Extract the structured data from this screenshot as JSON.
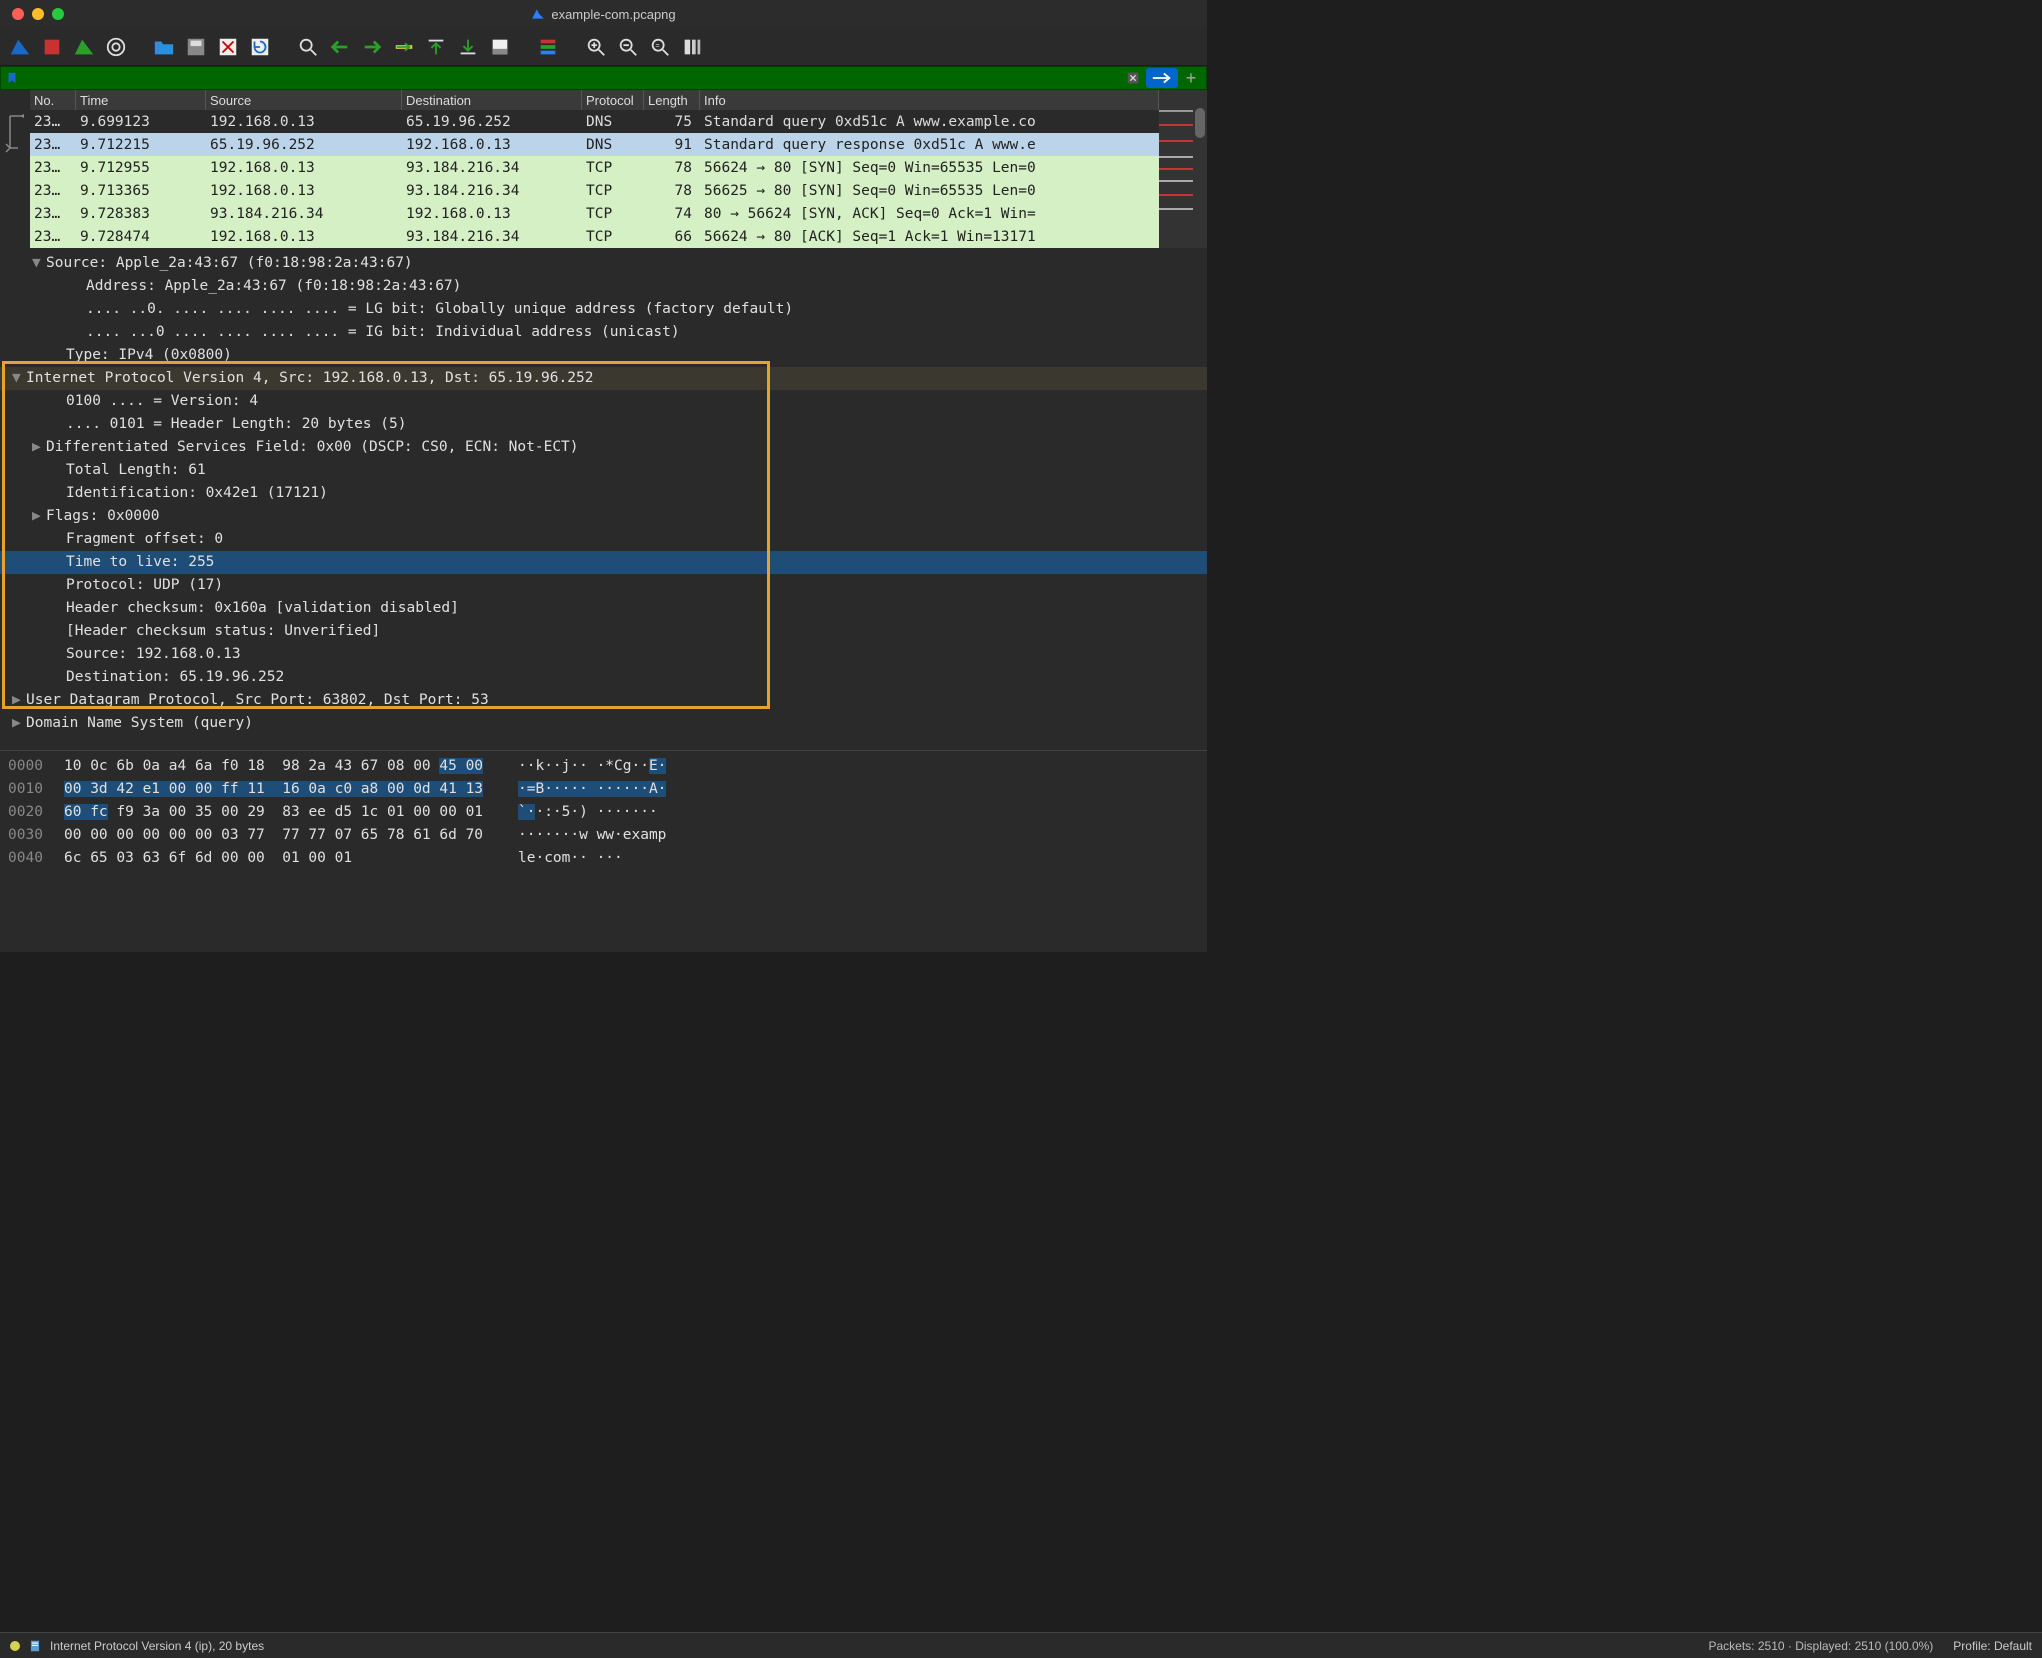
{
  "title": "example-com.pcapng",
  "filter_value": "",
  "columns": {
    "no": "No.",
    "time": "Time",
    "src": "Source",
    "dst": "Destination",
    "proto": "Protocol",
    "len": "Length",
    "info": "Info"
  },
  "packets": [
    {
      "no": "23…",
      "time": "9.699123",
      "src": "192.168.0.13",
      "dst": "65.19.96.252",
      "proto": "DNS",
      "len": "75",
      "info": "Standard query 0xd51c A www.example.co",
      "cls": "row-dns row-dark",
      "selected": false
    },
    {
      "no": "23…",
      "time": "9.712215",
      "src": "65.19.96.252",
      "dst": "192.168.0.13",
      "proto": "DNS",
      "len": "91",
      "info": "Standard query response 0xd51c A www.e",
      "cls": "row-dns sel",
      "selected": true
    },
    {
      "no": "23…",
      "time": "9.712955",
      "src": "192.168.0.13",
      "dst": "93.184.216.34",
      "proto": "TCP",
      "len": "78",
      "info": "56624 → 80 [SYN] Seq=0 Win=65535 Len=0",
      "cls": "row-tcp",
      "selected": false
    },
    {
      "no": "23…",
      "time": "9.713365",
      "src": "192.168.0.13",
      "dst": "93.184.216.34",
      "proto": "TCP",
      "len": "78",
      "info": "56625 → 80 [SYN] Seq=0 Win=65535 Len=0",
      "cls": "row-tcp",
      "selected": false
    },
    {
      "no": "23…",
      "time": "9.728383",
      "src": "93.184.216.34",
      "dst": "192.168.0.13",
      "proto": "TCP",
      "len": "74",
      "info": "80 → 56624 [SYN, ACK] Seq=0 Ack=1 Win=",
      "cls": "row-tcp",
      "selected": false
    },
    {
      "no": "23…",
      "time": "9.728474",
      "src": "192.168.0.13",
      "dst": "93.184.216.34",
      "proto": "TCP",
      "len": "66",
      "info": "56624 → 80 [ACK] Seq=1 Ack=1 Win=13171",
      "cls": "row-tcp",
      "selected": false
    }
  ],
  "details": [
    {
      "pad": 1,
      "arrow": "▼",
      "text": "Source: Apple_2a:43:67 (f0:18:98:2a:43:67)",
      "cls": ""
    },
    {
      "pad": 3,
      "arrow": "",
      "text": "Address: Apple_2a:43:67 (f0:18:98:2a:43:67)",
      "cls": ""
    },
    {
      "pad": 3,
      "arrow": "",
      "text": ".... ..0. .... .... .... .... = LG bit: Globally unique address (factory default)",
      "cls": ""
    },
    {
      "pad": 3,
      "arrow": "",
      "text": ".... ...0 .... .... .... .... = IG bit: Individual address (unicast)",
      "cls": ""
    },
    {
      "pad": 2,
      "arrow": "",
      "text": "Type: IPv4 (0x0800)",
      "cls": ""
    },
    {
      "pad": 0,
      "arrow": "▼",
      "text": "Internet Protocol Version 4, Src: 192.168.0.13, Dst: 65.19.96.252",
      "cls": "header-sel"
    },
    {
      "pad": 2,
      "arrow": "",
      "text": "0100 .... = Version: 4",
      "cls": ""
    },
    {
      "pad": 2,
      "arrow": "",
      "text": ".... 0101 = Header Length: 20 bytes (5)",
      "cls": ""
    },
    {
      "pad": 1,
      "arrow": "▶",
      "text": "Differentiated Services Field: 0x00 (DSCP: CS0, ECN: Not-ECT)",
      "cls": ""
    },
    {
      "pad": 2,
      "arrow": "",
      "text": "Total Length: 61",
      "cls": ""
    },
    {
      "pad": 2,
      "arrow": "",
      "text": "Identification: 0x42e1 (17121)",
      "cls": ""
    },
    {
      "pad": 1,
      "arrow": "▶",
      "text": "Flags: 0x0000",
      "cls": ""
    },
    {
      "pad": 2,
      "arrow": "",
      "text": "Fragment offset: 0",
      "cls": ""
    },
    {
      "pad": 2,
      "arrow": "",
      "text": "Time to live: 255",
      "cls": "sel"
    },
    {
      "pad": 2,
      "arrow": "",
      "text": "Protocol: UDP (17)",
      "cls": ""
    },
    {
      "pad": 2,
      "arrow": "",
      "text": "Header checksum: 0x160a [validation disabled]",
      "cls": ""
    },
    {
      "pad": 2,
      "arrow": "",
      "text": "[Header checksum status: Unverified]",
      "cls": ""
    },
    {
      "pad": 2,
      "arrow": "",
      "text": "Source: 192.168.0.13",
      "cls": ""
    },
    {
      "pad": 2,
      "arrow": "",
      "text": "Destination: 65.19.96.252",
      "cls": ""
    },
    {
      "pad": 0,
      "arrow": "▶",
      "text": "User Datagram Protocol, Src Port: 63802, Dst Port: 53",
      "cls": ""
    },
    {
      "pad": 0,
      "arrow": "▶",
      "text": "Domain Name System (query)",
      "cls": ""
    }
  ],
  "hex": [
    {
      "off": "0000",
      "bytes": [
        [
          "10 0c 6b 0a a4 6a f0 18  98 2a 43 67 08 00 ",
          false
        ],
        [
          "45 00",
          true
        ]
      ],
      "ascii": [
        [
          "··k··j·· ·*Cg··",
          false
        ],
        [
          "E·",
          true
        ]
      ]
    },
    {
      "off": "0010",
      "bytes": [
        [
          "00 3d 42 e1 00 00 ff 11  16 0a c0 a8 00 0d 41 13",
          true
        ]
      ],
      "ascii": [
        [
          "·=B····· ······A·",
          true
        ]
      ]
    },
    {
      "off": "0020",
      "bytes": [
        [
          "60 fc",
          true
        ],
        [
          " f9 3a 00 35 00 29  83 ee d5 1c 01 00 00 01",
          false
        ]
      ],
      "ascii": [
        [
          "`·",
          true
        ],
        [
          "·:·5·) ······· ",
          false
        ]
      ]
    },
    {
      "off": "0030",
      "bytes": [
        [
          "00 00 00 00 00 00 03 77  77 77 07 65 78 61 6d 70",
          false
        ]
      ],
      "ascii": [
        [
          "·······w ww·examp",
          false
        ]
      ]
    },
    {
      "off": "0040",
      "bytes": [
        [
          "6c 65 03 63 6f 6d 00 00  01 00 01",
          false
        ]
      ],
      "ascii": [
        [
          "le·com·· ···",
          false
        ]
      ]
    }
  ],
  "status": {
    "field": "Internet Protocol Version 4 (ip), 20 bytes",
    "packets": "Packets: 2510 · Displayed: 2510 (100.0%)",
    "profile": "Profile: Default"
  }
}
